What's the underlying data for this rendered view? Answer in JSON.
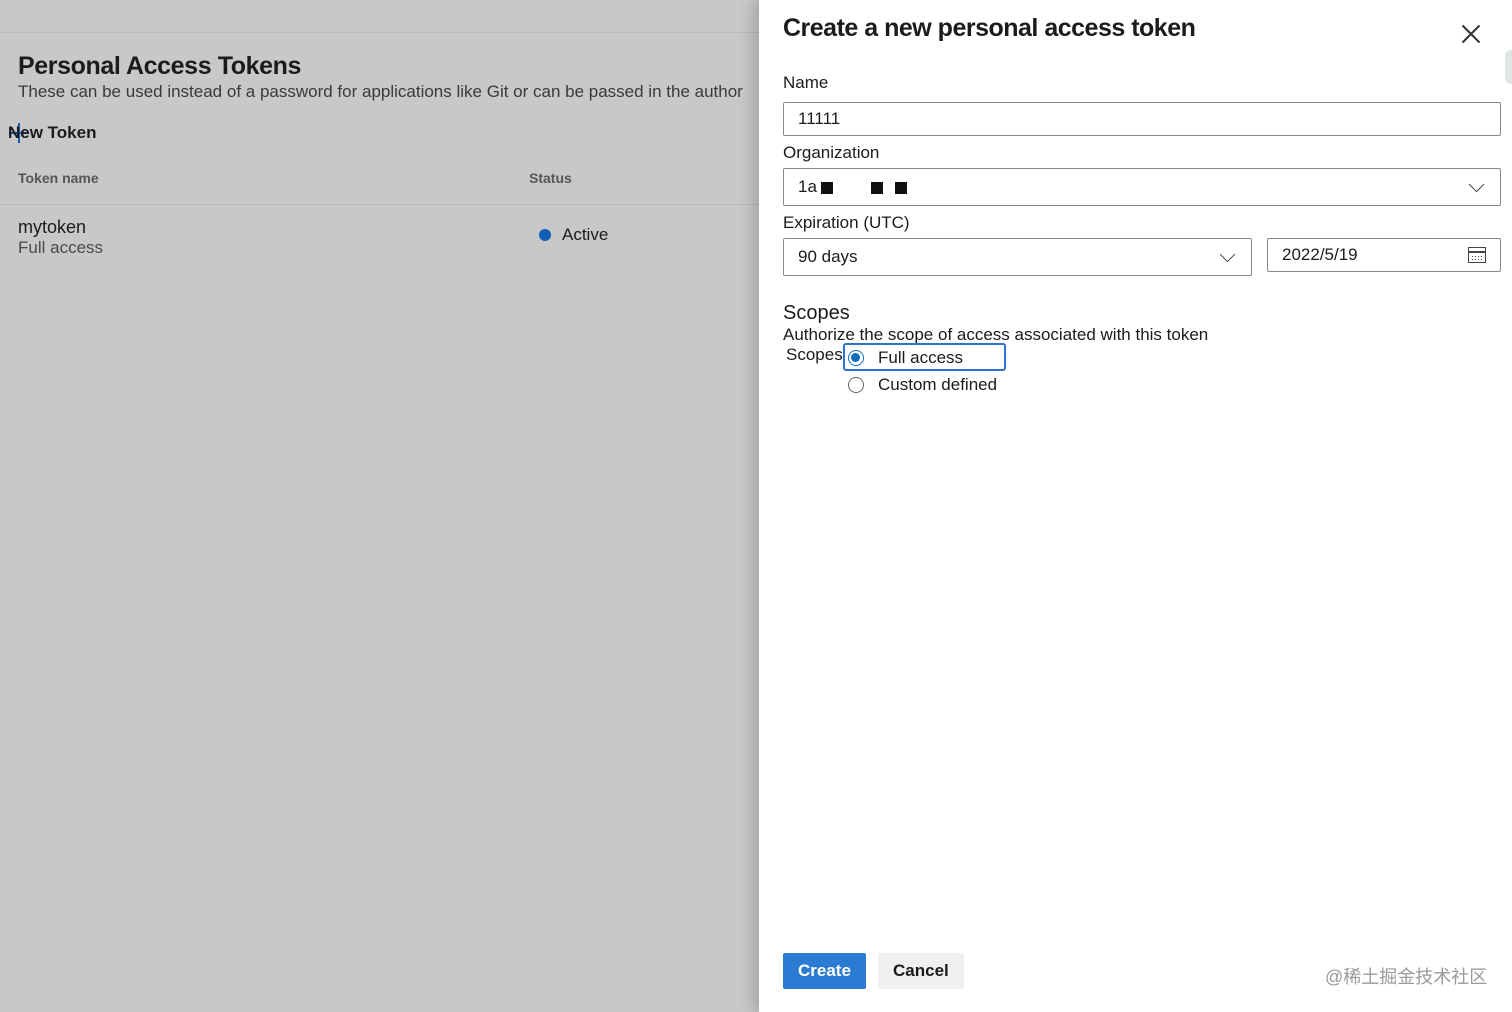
{
  "background": {
    "title": "Personal Access Tokens",
    "description": "These can be used instead of a password for applications like Git or can be passed in the author",
    "new_token_label": "New Token",
    "columns": {
      "token_name": "Token name",
      "status": "Status"
    },
    "rows": [
      {
        "name": "mytoken",
        "scope": "Full access",
        "status": "Active",
        "status_color": "#0f5fb2"
      }
    ]
  },
  "dialog": {
    "title": "Create a new personal access token",
    "name_label": "Name",
    "name_value": "11111",
    "organization_label": "Organization",
    "organization_value": "1a",
    "expiration_label": "Expiration (UTC)",
    "expiration_value": "90 days",
    "expiration_date": "2022/5/19",
    "scopes_heading": "Scopes",
    "scopes_description": "Authorize the scope of access associated with this token",
    "scopes_label": "Scopes",
    "scope_options": [
      {
        "label": "Full access",
        "selected": true
      },
      {
        "label": "Custom defined",
        "selected": false
      }
    ],
    "create_label": "Create",
    "cancel_label": "Cancel"
  },
  "watermark": "@稀土掘金技术社区",
  "colors": {
    "accent": "#2b7bd3",
    "overlay": "#c8c8c8",
    "focus": "#2f72d1"
  },
  "icons": [
    "plus-icon",
    "close-icon",
    "chevron-down-icon",
    "calendar-icon"
  ]
}
